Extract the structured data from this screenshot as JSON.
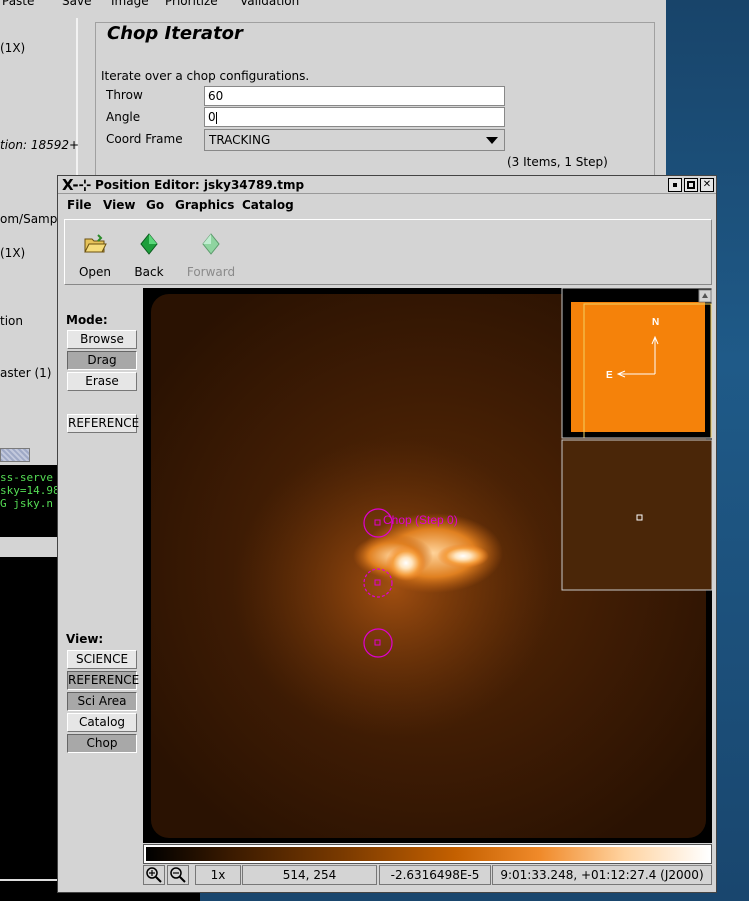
{
  "background_window": {
    "menu": [
      "Paste",
      "Save",
      "Image",
      "Prioritize",
      "Validation"
    ],
    "left_fragments": [
      "(1X)",
      "tion: 18592+",
      "om/Samp",
      "(1X)",
      "tion",
      "aster (1)"
    ],
    "terminal_lines": [
      "ss-serve",
      "sky=14.98",
      "G jsky.n"
    ],
    "chop_iterator": {
      "title": "Chop Iterator",
      "description": "Iterate over a chop configurations.",
      "throw_label": "Throw",
      "throw_value": "60",
      "angle_label": "Angle",
      "angle_value": "0",
      "coord_frame_label": "Coord Frame",
      "coord_frame_value": "TRACKING",
      "summary": "(3 Items, 1 Step)"
    }
  },
  "position_editor": {
    "title": "Position Editor: jsky34789.tmp",
    "title_icon": "X-⊹",
    "menu": [
      "File",
      "View",
      "Go",
      "Graphics",
      "Catalog"
    ],
    "toolbar": {
      "open_label": "Open",
      "back_label": "Back",
      "forward_label": "Forward"
    },
    "mode_label": "Mode:",
    "mode_buttons": [
      "Browse",
      "Drag",
      "Erase"
    ],
    "mode_selected": "Drag",
    "reference_button": "REFERENCE",
    "view_label": "View:",
    "view_buttons": [
      "SCIENCE",
      "REFERENCE",
      "Sci Area",
      "Catalog",
      "Chop"
    ],
    "view_selected": [
      "REFERENCE",
      "Sci Area",
      "Chop"
    ],
    "image": {
      "chop_label": "Chop (Step 0)",
      "compass_n": "N",
      "compass_e": "E"
    },
    "status": {
      "zoom": "1x",
      "pixel_coords": "514, 254",
      "pixel_value": "-2.6316498E-5",
      "world_coords": "9:01:33.248, +01:12:27.4 (J2000)"
    },
    "colors": {
      "magenta": "#e000d0",
      "image_orange": "#f5820a"
    }
  }
}
